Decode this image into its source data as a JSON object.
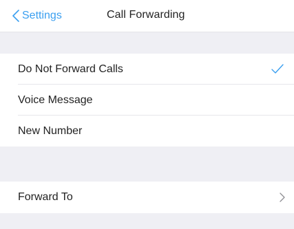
{
  "navbar": {
    "back_label": "Settings",
    "title": "Call Forwarding"
  },
  "forward_options": {
    "items": [
      {
        "label": "Do Not Forward Calls",
        "selected": true,
        "icon": "checkmark-icon"
      },
      {
        "label": "Voice Message",
        "selected": false
      },
      {
        "label": "New Number",
        "selected": false
      }
    ]
  },
  "forward_to": {
    "label": "Forward To",
    "icon": "chevron-right-icon"
  },
  "colors": {
    "accent": "#3a9ff0",
    "background": "#efeff4",
    "text": "#222222"
  }
}
